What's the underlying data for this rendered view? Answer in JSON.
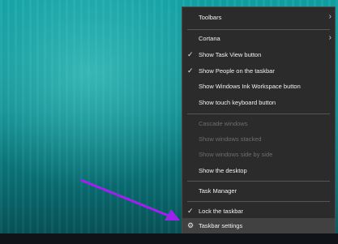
{
  "menu": {
    "items": [
      {
        "label": "Toolbars",
        "submenu": true
      },
      {
        "label": "Cortana",
        "submenu": true
      },
      {
        "label": "Show Task View button",
        "checked": true
      },
      {
        "label": "Show People on the taskbar",
        "checked": true
      },
      {
        "label": "Show Windows Ink Workspace button"
      },
      {
        "label": "Show touch keyboard button"
      },
      {
        "label": "Cascade windows",
        "disabled": true
      },
      {
        "label": "Show windows stacked",
        "disabled": true
      },
      {
        "label": "Show windows side by side",
        "disabled": true
      },
      {
        "label": "Show the desktop"
      },
      {
        "label": "Task Manager"
      },
      {
        "label": "Lock the taskbar",
        "checked": true
      },
      {
        "label": "Taskbar settings",
        "icon": "gear-icon"
      }
    ],
    "check_glyph": "✓",
    "chevron_glyph": "›",
    "gear_glyph": "⚙"
  },
  "annotation": {
    "color": "#a020f0"
  }
}
